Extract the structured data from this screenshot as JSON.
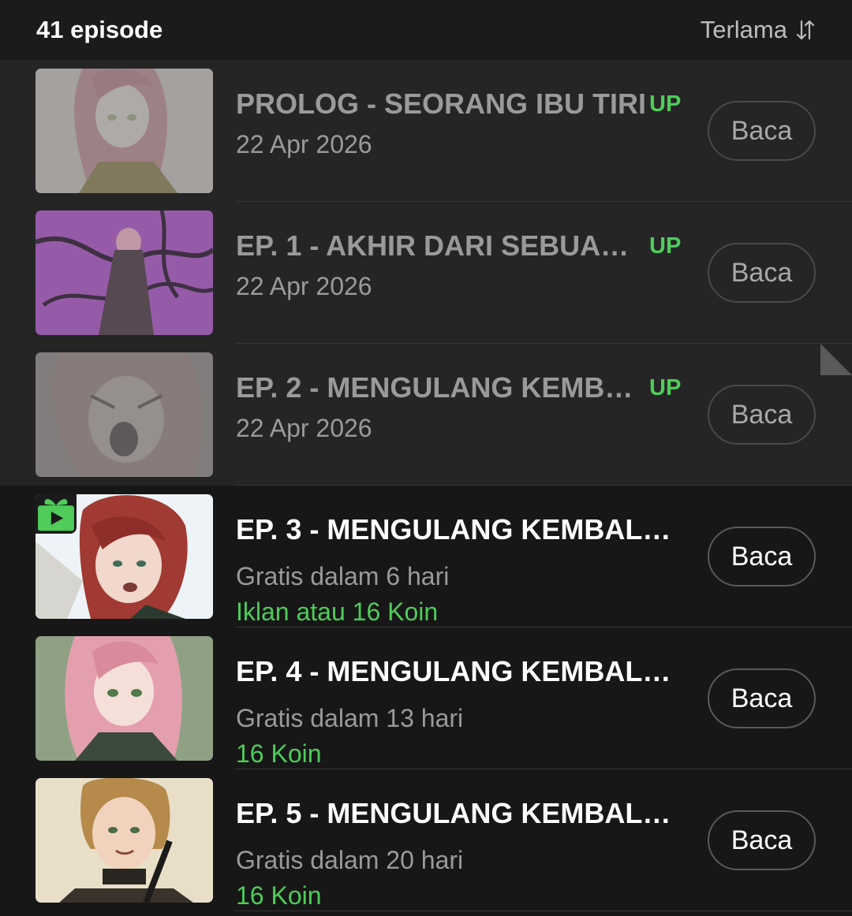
{
  "header": {
    "episode_count": "41 episode",
    "sort_label": "Terlama"
  },
  "episodes": [
    {
      "title": "PROLOG - SEORANG IBU TIRI",
      "badge": "UP",
      "date": "22 Apr 2026",
      "button": "Baca",
      "read": true
    },
    {
      "title": "EP. 1 - AKHIR DARI SEBUAH…",
      "badge": "UP",
      "date": "22 Apr 2026",
      "button": "Baca",
      "read": true
    },
    {
      "title": "EP. 2 - MENGULANG KEMB…",
      "badge": "UP",
      "date": "22 Apr 2026",
      "button": "Baca",
      "read": true
    },
    {
      "title": "EP. 3 - MENGULANG KEMBALI…",
      "free_in": "Gratis dalam 6 hari",
      "price": "Iklan atau 16 Koin",
      "button": "Baca",
      "read": false,
      "gift": true
    },
    {
      "title": "EP. 4 - MENGULANG KEMBALI…",
      "free_in": "Gratis dalam 13 hari",
      "price": "16 Koin",
      "button": "Baca",
      "read": false
    },
    {
      "title": "EP. 5 - MENGULANG KEMBALI…",
      "free_in": "Gratis dalam 20 hari",
      "price": "16 Koin",
      "button": "Baca",
      "read": false
    }
  ],
  "colors": {
    "background": "#171717",
    "read_row": "#252525",
    "accent_green": "#4fcc5a"
  },
  "icons": [
    "sort-icon",
    "gift-icon"
  ]
}
